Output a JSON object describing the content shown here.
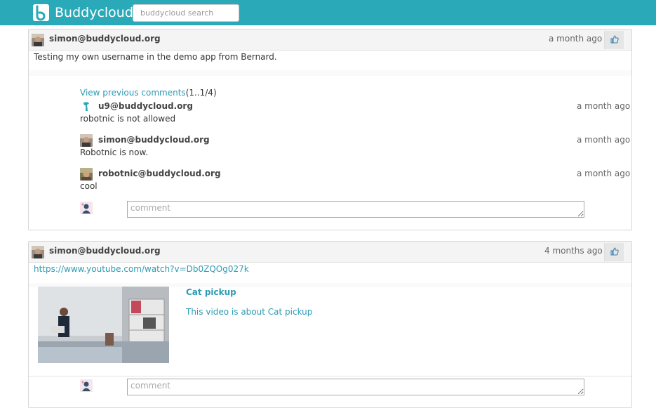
{
  "app": {
    "name": "Buddycloud",
    "search_placeholder": "buddycloud search"
  },
  "posts": [
    {
      "author": "simon@buddycloud.org",
      "time": "a month ago",
      "body": "Testing my own username in the demo app from Bernard.",
      "view_previous_label": "View previous comments",
      "view_previous_count": "(1..1/4)",
      "comments": [
        {
          "author": "u9@buddycloud.org",
          "time": "a month ago",
          "text": "robotnic is not allowed"
        },
        {
          "author": "simon@buddycloud.org",
          "time": "a month ago",
          "text": "Robotnic is now."
        },
        {
          "author": "robotnic@buddycloud.org",
          "time": "a month ago",
          "text": "cool"
        }
      ],
      "comment_placeholder": "comment"
    },
    {
      "author": "simon@buddycloud.org",
      "time": "4 months ago",
      "link": "https://www.youtube.com/watch?v=Db0ZQOg027k",
      "embed": {
        "title": "Cat pickup",
        "description": "This video is about Cat pickup"
      },
      "comment_placeholder": "comment"
    }
  ],
  "colors": {
    "header": "#2aa9b8",
    "link": "#2c9bb3"
  }
}
